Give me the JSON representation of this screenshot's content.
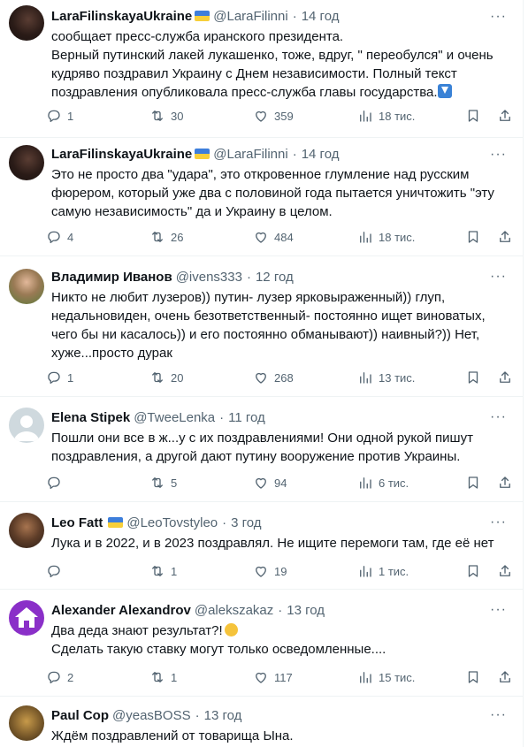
{
  "tweets": [
    {
      "name": "LaraFilinskayaUkraine",
      "flag": true,
      "handle": "@LaraFilinni",
      "time": "14 год",
      "text": "сообщает пресс-служба иранского президента.\nВерный путинский лакей лукашенко, тоже, вдруг, \" переобулся\" и очень кудряво поздравил Украину с Днем независимости. Полный текст поздравления опубликовала пресс-служба главы государства.",
      "emoji_end": "down-arrow-emoji",
      "replies": "1",
      "reposts": "30",
      "likes": "359",
      "views": "18 тис."
    },
    {
      "name": "LaraFilinskayaUkraine",
      "flag": true,
      "handle": "@LaraFilinni",
      "time": "14 год",
      "text": "Это не просто два \"удара\", это откровенное глумление над русским фюрером, который уже два с половиной года пытается уничтожить \"эту самую независимость\" да и Украину в целом.",
      "replies": "4",
      "reposts": "26",
      "likes": "484",
      "views": "18 тис."
    },
    {
      "name": "Владимир Иванов",
      "flag": false,
      "handle": "@ivens333",
      "time": "12 год",
      "text": "Никто не любит лузеров)) путин- лузер ярковыраженный)) глуп, недальновиден, очень безответственный- постоянно ищет виноватых, чего бы ни касалось)) и его постоянно обманывают)) наивный?)) Нет, хуже...просто дурак",
      "replies": "1",
      "reposts": "20",
      "likes": "268",
      "views": "13 тис."
    },
    {
      "name": "Elena Stipek",
      "flag": false,
      "handle": "@TweeLenka",
      "time": "11 год",
      "text": "Пошли они все в ж...у с их поздравлениями! Они одной рукой пишут поздравления, а другой дают путину вооружение против Украины.",
      "replies": "",
      "reposts": "5",
      "likes": "94",
      "views": "6 тис."
    },
    {
      "name": "Leo Fatt",
      "flag": true,
      "handle": "@LeoTovstyleo",
      "time": "3 год",
      "text": "Лука и в 2022, и в 2023 поздравлял. Не ищите перемоги там, где её нет",
      "replies": "",
      "reposts": "1",
      "likes": "19",
      "views": "1 тис."
    },
    {
      "name": "Alexander Alexandrov",
      "flag": false,
      "handle": "@alekszakaz",
      "time": "13 год",
      "text": "Два деда знают результат?!",
      "emoji_end": "thinking-face-emoji",
      "text2": "Сделать такую ставку могут только осведомленные....",
      "replies": "2",
      "reposts": "1",
      "likes": "117",
      "views": "15 тис."
    },
    {
      "name": "Paul Cop",
      "flag": false,
      "handle": "@yeasBOSS",
      "time": "13 год",
      "text": "Ждём поздравлений от товарища Ына."
    }
  ],
  "icons": {
    "reply": "reply-icon",
    "repost": "repost-icon",
    "like": "heart-icon",
    "views": "views-chart-icon",
    "bookmark": "bookmark-icon",
    "share": "share-icon",
    "more": "more-icon"
  },
  "more_label": "···",
  "colors": {
    "secondary_text": "#536471",
    "divider": "#eff3f4",
    "flag_blue": "#3d7edb",
    "flag_yellow": "#f7cf3a"
  }
}
